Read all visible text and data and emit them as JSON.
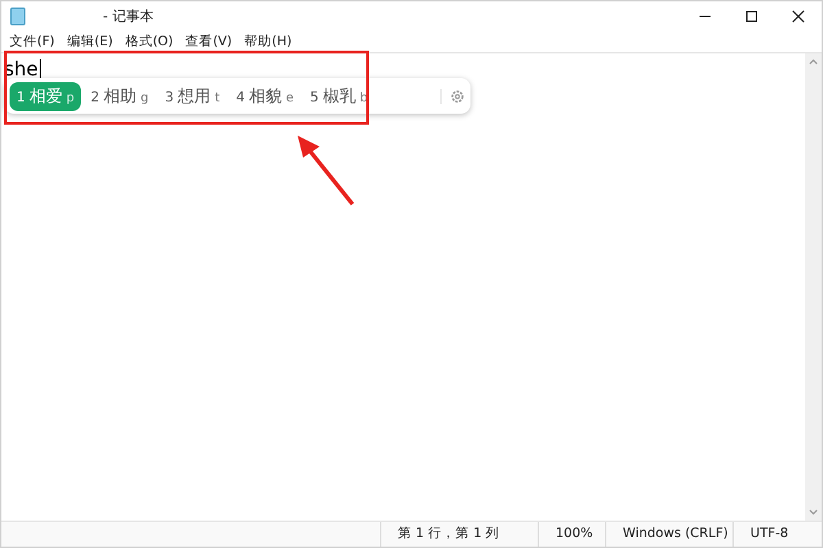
{
  "window": {
    "title": "- 记事本"
  },
  "menu": [
    "文件(F)",
    "编辑(E)",
    "格式(O)",
    "查看(V)",
    "帮助(H)"
  ],
  "editor": {
    "composition": "she"
  },
  "ime": {
    "candidates": [
      {
        "number": "1",
        "text": "相爱",
        "hint": "p",
        "selected": true
      },
      {
        "number": "2",
        "text": "相助",
        "hint": "g",
        "selected": false
      },
      {
        "number": "3",
        "text": "想用",
        "hint": "t",
        "selected": false
      },
      {
        "number": "4",
        "text": "相貌",
        "hint": "e",
        "selected": false
      },
      {
        "number": "5",
        "text": "椒乳",
        "hint": "b",
        "selected": false
      }
    ]
  },
  "status_bar": [
    "第 1 行，第 1 列",
    "100%",
    "Windows (CRLF)",
    "UTF-8"
  ]
}
